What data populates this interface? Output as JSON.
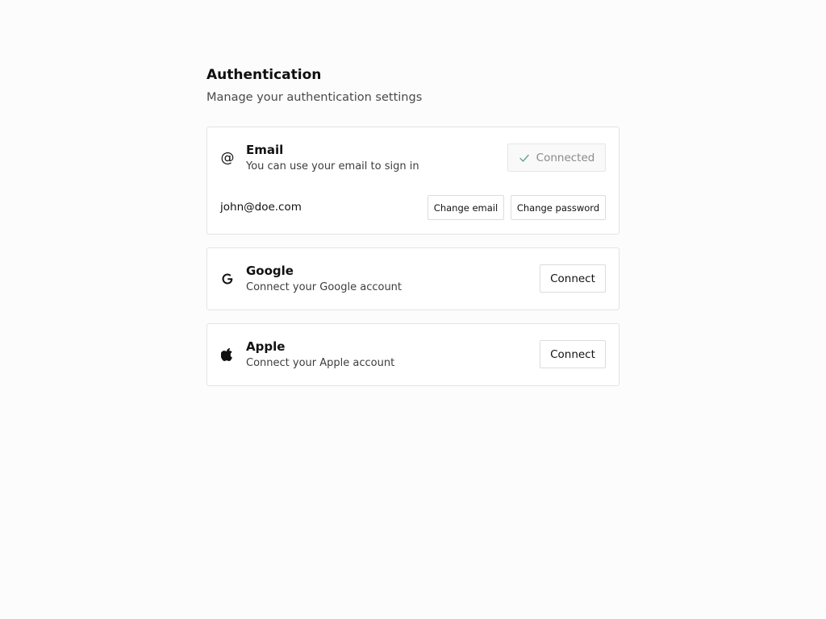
{
  "header": {
    "title": "Authentication",
    "subtitle": "Manage your authentication settings"
  },
  "providers": {
    "email": {
      "icon": "at-sign-icon",
      "name": "Email",
      "description": "You can use your email to sign in",
      "status_label": "Connected",
      "address": "john@doe.com",
      "change_email_label": "Change email",
      "change_password_label": "Change password"
    },
    "google": {
      "icon": "google-icon",
      "name": "Google",
      "description": "Connect your Google account",
      "connect_label": "Connect"
    },
    "apple": {
      "icon": "apple-icon",
      "name": "Apple",
      "description": "Connect your Apple account",
      "connect_label": "Connect"
    }
  },
  "colors": {
    "background": "#fcfcfc",
    "card": "#ffffff",
    "border": "#e3e3e3",
    "check": "#5fa88c",
    "muted_text": "#8a8a8a"
  }
}
